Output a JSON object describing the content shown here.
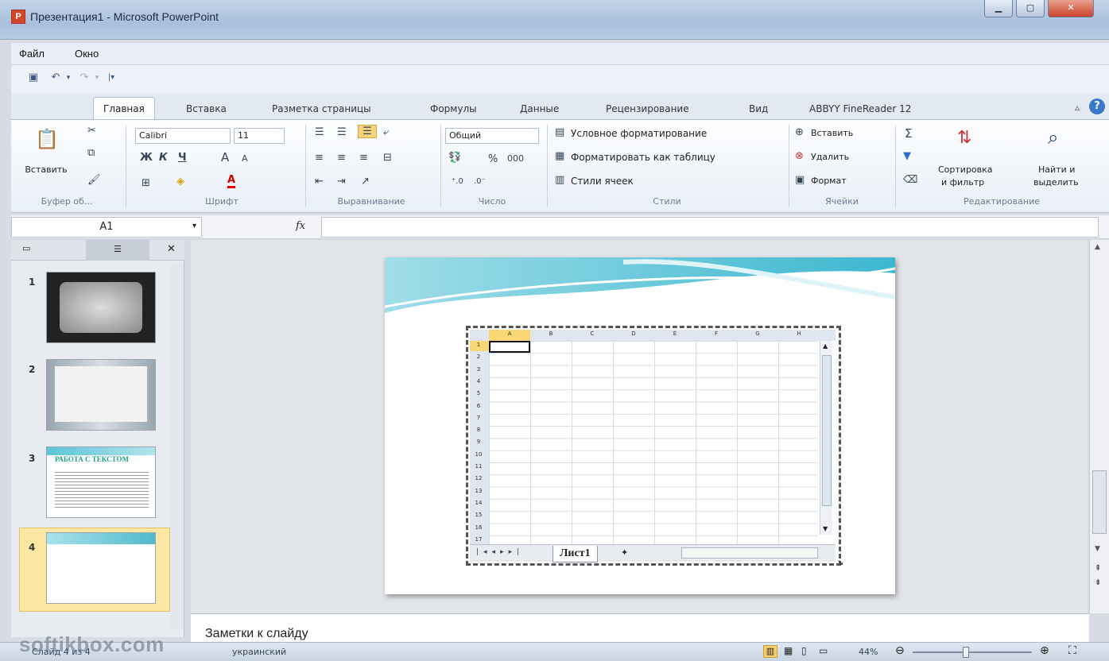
{
  "window": {
    "title": "Презентация1 - Microsoft PowerPoint",
    "app_icon": "P"
  },
  "menu": [
    "Файл",
    "Окно"
  ],
  "tabs": [
    "Главная",
    "Вставка",
    "Разметка страницы",
    "Формулы",
    "Данные",
    "Рецензирование",
    "Вид",
    "ABBYY FineReader 12"
  ],
  "ribbon": {
    "clipboard": {
      "paste_label": "Вставить",
      "group_label": "Буфер об..."
    },
    "font": {
      "font_name": "Calibri",
      "font_size": "11",
      "bold": "Ж",
      "italic": "К",
      "underline": "Ч",
      "grow": "A",
      "shrink": "A",
      "group_label": "Шрифт"
    },
    "alignment": {
      "group_label": "Выравнивание"
    },
    "number": {
      "format": "Общий",
      "percent": "%",
      "thousands": "000",
      "group_label": "Число"
    },
    "styles": {
      "conditional": "Условное форматирование",
      "as_table": "Форматировать как таблицу",
      "cell_styles": "Стили ячеек",
      "group_label": "Стили"
    },
    "cells": {
      "insert": "Вставить",
      "delete": "Удалить",
      "format": "Формат",
      "group_label": "Ячейки"
    },
    "editing": {
      "sigma": "Σ",
      "sort_line1": "Сортировка",
      "sort_line2": "и фильтр",
      "find_line1": "Найти и",
      "find_line2": "выделить",
      "group_label": "Редактирование"
    }
  },
  "formula_bar": {
    "name_box": "A1",
    "fx": "fx",
    "formula": ""
  },
  "slides": [
    {
      "num": "1"
    },
    {
      "num": "2"
    },
    {
      "num": "3",
      "title_text": "РАБОТА С ТЕКСТОМ"
    },
    {
      "num": "4"
    }
  ],
  "spreadsheet": {
    "columns": [
      "A",
      "B",
      "C",
      "D",
      "E",
      "F",
      "G",
      "H"
    ],
    "rows": [
      "1",
      "2",
      "3",
      "4",
      "5",
      "6",
      "7",
      "8",
      "9",
      "10",
      "11",
      "12",
      "13",
      "14",
      "15",
      "16",
      "17"
    ],
    "sheet_tab": "Лист1"
  },
  "notes": {
    "placeholder": "Заметки к слайду"
  },
  "status": {
    "slide_label": "Слайд 4 из 4",
    "language": "украинский",
    "zoom": "44%",
    "zoom_level": 0.44
  },
  "watermark": "softikbox.com",
  "colors": {
    "accent": "#d24726",
    "ribbon_bg": "#e9eff7",
    "active_cell": "#f9d775"
  }
}
